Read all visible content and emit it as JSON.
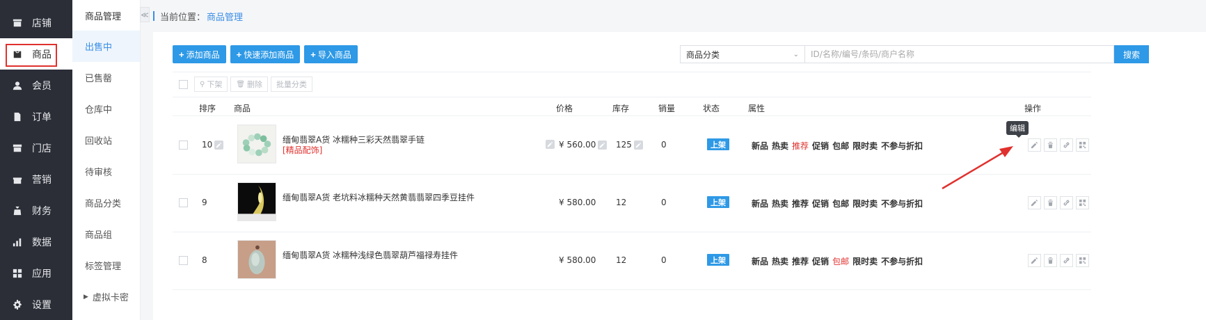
{
  "nav": {
    "items": [
      {
        "label": "店铺",
        "icon": "store-icon"
      },
      {
        "label": "商品",
        "icon": "goods-icon",
        "active": true
      },
      {
        "label": "会员",
        "icon": "member-icon"
      },
      {
        "label": "订单",
        "icon": "order-icon"
      },
      {
        "label": "门店",
        "icon": "shop-icon"
      },
      {
        "label": "营销",
        "icon": "gift-icon"
      },
      {
        "label": "财务",
        "icon": "finance-icon"
      },
      {
        "label": "数据",
        "icon": "chart-icon"
      },
      {
        "label": "应用",
        "icon": "apps-icon"
      },
      {
        "label": "设置",
        "icon": "gear-icon"
      }
    ]
  },
  "submenu": {
    "title": "商品管理",
    "collapse_glyph": "≪",
    "items": [
      "出售中",
      "已售罄",
      "仓库中",
      "回收站",
      "待审核",
      "商品分类",
      "商品组",
      "标签管理",
      "虚拟卡密"
    ]
  },
  "breadcrumb": {
    "prefix": "当前位置：",
    "current": "商品管理"
  },
  "toolbar": {
    "add": "添加商品",
    "quick_add": "快速添加商品",
    "import": "导入商品"
  },
  "filter": {
    "category": "商品分类",
    "placeholder": "ID/名称/编号/条码/商户名称",
    "search": "搜索"
  },
  "bulk": {
    "off_shelf": "下架",
    "delete": "删除",
    "batch_category": "批量分类"
  },
  "table": {
    "headers": {
      "sort": "排序",
      "goods": "商品",
      "price": "价格",
      "stock": "库存",
      "sales": "销量",
      "status": "状态",
      "attrs": "属性",
      "ops": "操作"
    },
    "rows": [
      {
        "sort": "10",
        "name": "缅甸翡翠A货 冰糯种三彩天然翡翠手链",
        "tag": "[精品配饰]",
        "price": "¥ 560.00",
        "stock": "125",
        "sales": "0",
        "status": "上架",
        "attrs": [
          {
            "t": "新品",
            "on": false
          },
          {
            "t": "热卖",
            "on": false
          },
          {
            "t": "推荐",
            "on": true
          },
          {
            "t": "促销",
            "on": false
          },
          {
            "t": "包邮",
            "on": false
          },
          {
            "t": "限时卖",
            "on": false
          },
          {
            "t": "不参与折扣",
            "on": false
          }
        ]
      },
      {
        "sort": "9",
        "name": "缅甸翡翠A货 老坑料冰糯种天然黄翡翡翠四季豆挂件",
        "tag": "",
        "price": "¥ 580.00",
        "stock": "12",
        "sales": "0",
        "status": "上架",
        "attrs": [
          {
            "t": "新品",
            "on": false
          },
          {
            "t": "热卖",
            "on": false
          },
          {
            "t": "推荐",
            "on": false
          },
          {
            "t": "促销",
            "on": false
          },
          {
            "t": "包邮",
            "on": false
          },
          {
            "t": "限时卖",
            "on": false
          },
          {
            "t": "不参与折扣",
            "on": false
          }
        ]
      },
      {
        "sort": "8",
        "name": "缅甸翡翠A货 冰糯种浅绿色翡翠葫芦福禄寿挂件",
        "tag": "",
        "price": "¥ 580.00",
        "stock": "12",
        "sales": "0",
        "status": "上架",
        "attrs": [
          {
            "t": "新品",
            "on": false
          },
          {
            "t": "热卖",
            "on": false
          },
          {
            "t": "推荐",
            "on": false
          },
          {
            "t": "促销",
            "on": false
          },
          {
            "t": "包邮",
            "on": true
          },
          {
            "t": "限时卖",
            "on": false
          },
          {
            "t": "不参与折扣",
            "on": false
          }
        ]
      }
    ]
  },
  "tooltip": "编辑",
  "colors": {
    "accent": "#2e99e6",
    "highlight": "#e0312e",
    "nav_bg": "#2b2e37"
  }
}
